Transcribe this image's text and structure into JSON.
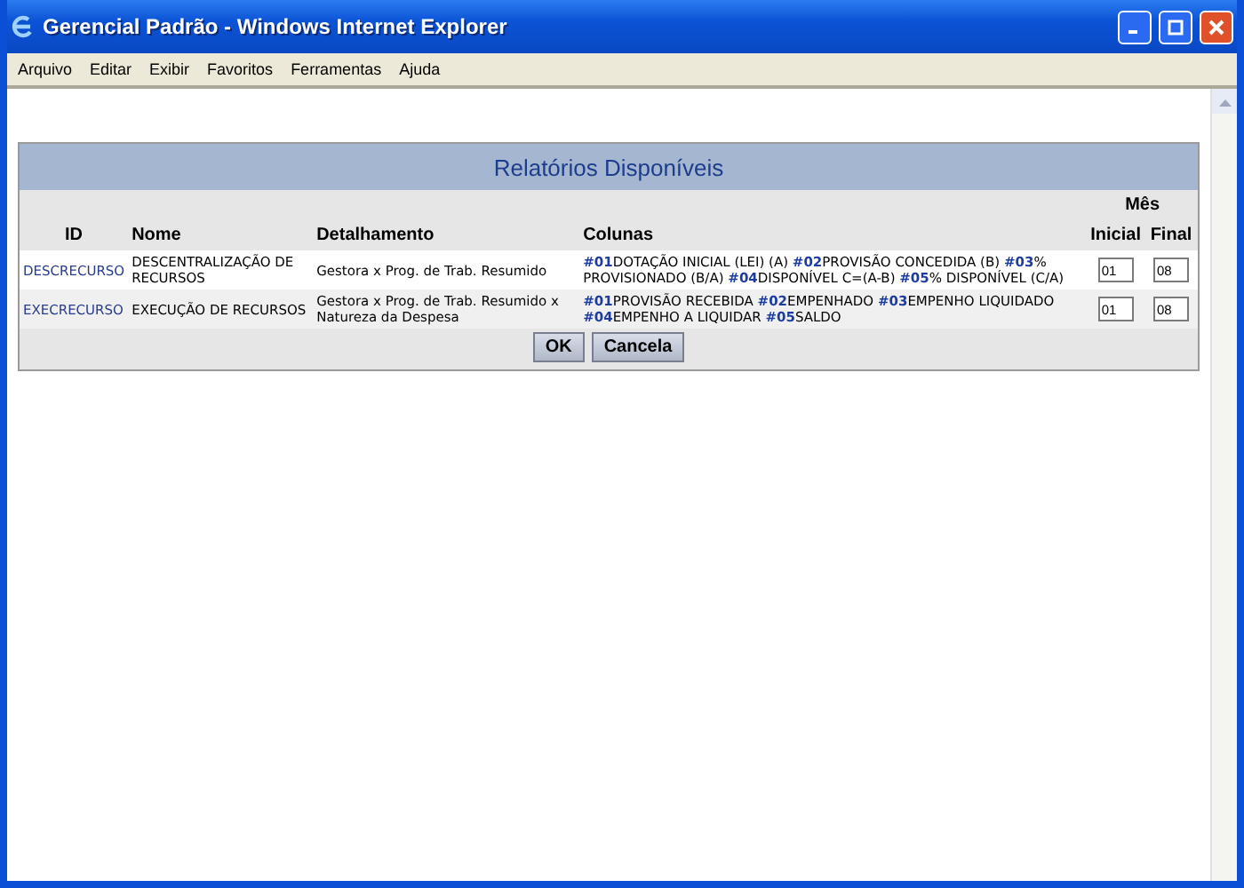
{
  "window": {
    "title": "Gerencial Padrão - Windows Internet Explorer"
  },
  "menu": [
    "Arquivo",
    "Editar",
    "Exibir",
    "Favoritos",
    "Ferramentas",
    "Ajuda"
  ],
  "report": {
    "title": "Relatórios Disponíveis",
    "group_header": "Mês",
    "columns": [
      "ID",
      "Nome",
      "Detalhamento",
      "Colunas",
      "Inicial",
      "Final"
    ],
    "rows": [
      {
        "id": "DESCRECURSO",
        "nome": "DESCENTRALIZAÇÃO DE RECURSOS",
        "detalhamento": "Gestora x Prog. de Trab. Resumido",
        "colunas": "**#01**DOTAÇÃO INICIAL (LEI) (A) **#02**PROVISÃO CONCEDIDA (B) **#03**% PROVISIONADO (B/A) **#04**DISPONÍVEL C=(A-B) **#05**% DISPONÍVEL (C/A)",
        "inicial": "01",
        "final": "08"
      },
      {
        "id": "EXECRECURSO",
        "nome": "EXECUÇÃO DE RECURSOS",
        "detalhamento": "Gestora x Prog. de Trab. Resumido x Natureza da Despesa",
        "colunas": "**#01**PROVISÃO RECEBIDA **#02**EMPENHADO **#03**EMPENHO LIQUIDADO **#04**EMPENHO A LIQUIDAR **#05**SALDO",
        "inicial": "01",
        "final": "08"
      }
    ],
    "buttons": [
      "OK",
      "Cancela"
    ]
  }
}
